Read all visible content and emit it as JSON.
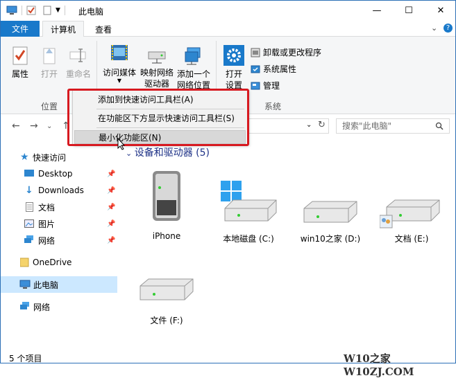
{
  "window": {
    "title": "此电脑"
  },
  "tabs": {
    "file": "文件",
    "computer": "计算机",
    "view": "查看"
  },
  "ribbon": {
    "location_group": {
      "label": "位置",
      "properties": "属性",
      "open": "打开",
      "rename": "重命名"
    },
    "network_group": {
      "media": "访问媒体",
      "map_drive_1": "映射网络",
      "map_drive_2": "驱动器",
      "add_location_1": "添加一个",
      "add_location_2": "网络位置"
    },
    "system_group": {
      "label": "系统",
      "open_settings_1": "打开",
      "open_settings_2": "设置",
      "uninstall": "卸载或更改程序",
      "sys_props": "系统属性",
      "manage": "管理"
    }
  },
  "search": {
    "placeholder": "搜索\"此电脑\""
  },
  "context_menu": {
    "item1": "添加到快速访问工具栏(A)",
    "item2": "在功能区下方显示快速访问工具栏(S)",
    "item3": "最小化功能区(N)"
  },
  "navpane": {
    "quick_access": "快速访问",
    "desktop": "Desktop",
    "downloads": "Downloads",
    "documents": "文档",
    "pictures": "图片",
    "network_qa": "网络",
    "onedrive": "OneDrive",
    "this_pc": "此电脑",
    "network": "网络"
  },
  "content": {
    "section": "设备和驱动器 (5)",
    "drives": [
      "iPhone",
      "本地磁盘 (C:)",
      "win10之家 (D:)",
      "文档 (E:)",
      "文件 (F:)"
    ]
  },
  "status": {
    "items": "5 个项目"
  },
  "watermark": "W10之家 W10ZJ.COM",
  "colors": {
    "accent": "#1979ca",
    "highlight_border": "#d71920",
    "selected_nav": "#cce8ff"
  }
}
